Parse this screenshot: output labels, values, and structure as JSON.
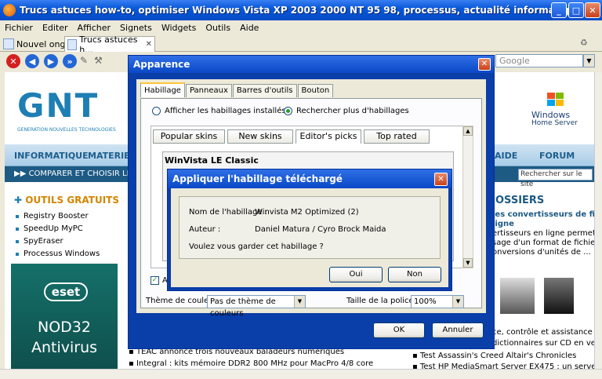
{
  "browser": {
    "title": "Trucs astuces how-to, optimiser Windows Vista XP 2003 2000 NT 95 98, processus, actualité informatique, jeux vidéo PC consol...",
    "menu": [
      "Fichier",
      "Editer",
      "Afficher",
      "Signets",
      "Widgets",
      "Outils",
      "Aide"
    ],
    "new_tab_label": "Nouvel onglet",
    "active_tab_label": "Trucs astuces h...",
    "search_placeholder": "Google"
  },
  "webpage": {
    "logo_letters": "GNT",
    "logo_sub": "GENERATION NOUVELLES TECHNOLOGIES",
    "nav": [
      "INFORMATIQUE",
      "MATERIEL",
      "AIDE",
      "FORUM"
    ],
    "compare": "COMPARER ET CHOISIR LES OFFI",
    "site_search": "Rechercher sur le site",
    "tools_title": "OUTILS GRATUITS",
    "tools": [
      "Registry Booster",
      "SpeedUp MyPC",
      "SpyEraser",
      "Processus Windows"
    ],
    "eset_badge": "eset",
    "eset_product": "NOD32",
    "eset_type": "Antivirus",
    "whs_line1": "Windows",
    "whs_line2": "Home Server",
    "dossiers": "OSSIERS",
    "right_texts": [
      "les convertisseurs de fichi",
      "ligne",
      "ertisseurs en ligne permettent",
      "sage d'un format de fichier à",
      "onversions d'unités de ...",
      "ce, contrôle et assistance à d",
      "dictionnaires sur CD en versio"
    ],
    "news": [
      "TEAC annonce trois nouveaux baladeurs numériques",
      "Integral : kits mémoire DDR2 800 MHz pour MacPro 4/8 core"
    ],
    "bottom_list": [
      "Test Assassin's Creed Altair's Chronicles",
      "Test HP MediaSmart Server EX475 : un serveur multim"
    ]
  },
  "apparence": {
    "title": "Apparence",
    "tabs": [
      "Habillage",
      "Panneaux",
      "Barres d'outils",
      "Bouton"
    ],
    "radio_installed": "Afficher les habillages installés",
    "radio_more": "Rechercher plus d'habillages",
    "skin_tabs": [
      "Popular skins",
      "New skins",
      "Editor's picks",
      "Top rated"
    ],
    "preview_title": "WinVista LE Classic",
    "check_label": "A",
    "color_label": "Thème de couleurs",
    "color_value": "Pas de thème de couleurs",
    "font_label": "Taille de la police",
    "font_value": "100%",
    "ok": "OK",
    "cancel": "Annuler"
  },
  "confirm": {
    "title": "Appliquer l'habillage téléchargé",
    "name_label": "Nom de l'habillage :",
    "name_value": "Winvista M2 Optimized (2)",
    "author_label": "Auteur :",
    "author_value": "Daniel Matura / Cyro Brock Maida",
    "question": "Voulez vous garder cet habillage ?",
    "yes": "Oui",
    "no": "Non"
  }
}
